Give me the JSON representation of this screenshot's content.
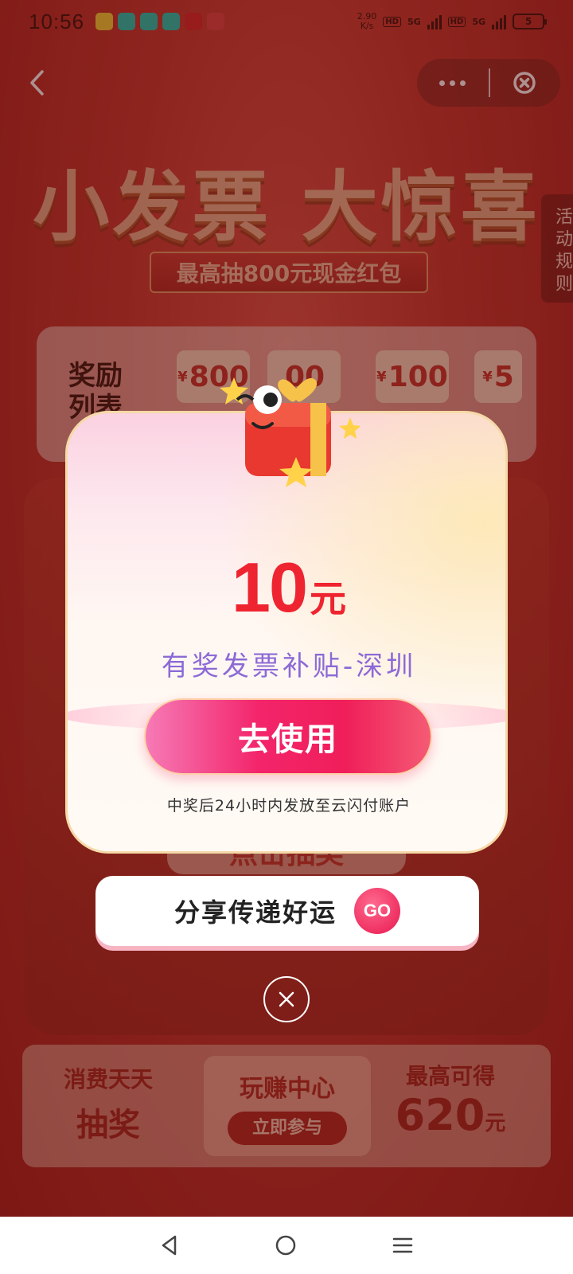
{
  "status_bar": {
    "time": "10:56",
    "net_speed": "2.90\nK/s",
    "sim1_tag": "5G",
    "sim2_tag": "5G",
    "hd_tag": "HD",
    "battery": "5",
    "app_icon_colors": [
      "#f5d23a",
      "#1fc8b5",
      "#1fc8b5",
      "#1fc8b5",
      "#d92b2b",
      "#e04545"
    ]
  },
  "nav": {
    "back_icon": "chevron-left-icon",
    "more_icon": "more-dots-icon",
    "close_icon": "close-circle-icon"
  },
  "hero": {
    "title": "小发票 大惊喜",
    "subtitle": "最高抽800元现金红包",
    "rules_tab": "活动规则"
  },
  "reward_list": {
    "label": "奖励列表",
    "chips": [
      {
        "currency": "¥",
        "value": "800"
      },
      {
        "currency": "",
        "value": "00"
      },
      {
        "currency": "¥",
        "value": "100"
      },
      {
        "currency": "¥",
        "value": "5"
      }
    ]
  },
  "machine": {
    "draw_button": "点击抽奖"
  },
  "popup": {
    "amount": "10",
    "unit": "元",
    "prize_title": "有奖发票补贴-深圳",
    "use_button": "去使用",
    "note": "中奖后24小时内发放至云闪付账户"
  },
  "share": {
    "label": "分享传递好运",
    "go": "GO"
  },
  "promo": {
    "left_line1": "消费天天",
    "left_line2": "抽奖",
    "mid_title": "玩赚中心",
    "mid_button": "立即参与",
    "right_line1": "最高可得",
    "right_value": "620",
    "right_unit": "元"
  },
  "colors": {
    "accent_red": "#ee2430",
    "button_pink": "#f3246a",
    "title_purple": "#8c6ad6"
  }
}
